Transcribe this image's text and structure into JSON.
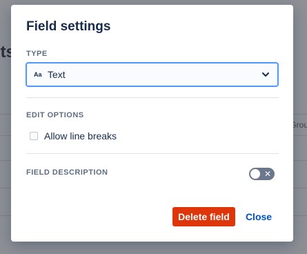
{
  "background": {
    "heading_fragment": "nts",
    "column_fragment": "Grou"
  },
  "modal": {
    "title": "Field settings",
    "type_section": {
      "label": "TYPE",
      "selected_icon": "Aa",
      "selected_value": "Text"
    },
    "edit_options": {
      "label": "EDIT OPTIONS",
      "checkbox_label": "Allow line breaks",
      "checked": false
    },
    "field_description": {
      "label": "FIELD DESCRIPTION",
      "toggle_on": false
    },
    "buttons": {
      "delete_label": "Delete field",
      "close_label": "Close"
    }
  },
  "colors": {
    "primary": "#0052cc",
    "danger": "#de350b",
    "focus": "#4c9aff",
    "text": "#172b4d"
  }
}
